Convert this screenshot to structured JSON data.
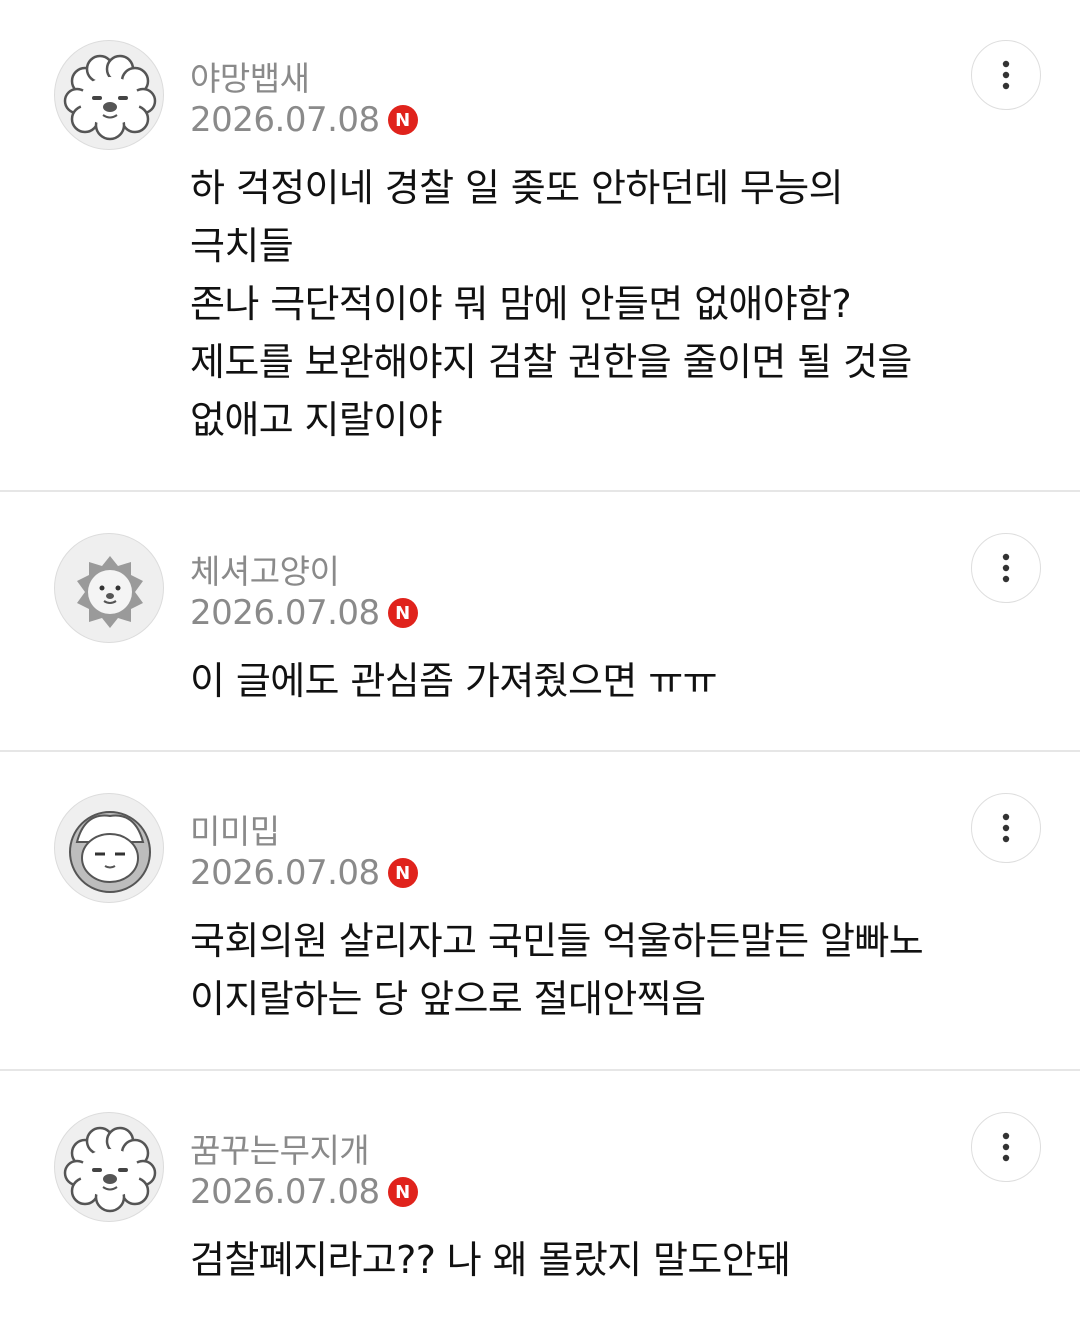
{
  "comments": [
    {
      "avatar_icon": "poodle-dog-icon",
      "username": "야망뱁새",
      "date": "2026.07.08",
      "badge": "N",
      "lines": [
        "하 걱정이네 경찰 일 좆또 안하던데 무능의",
        "극치들",
        "존나 극단적이야 뭐 맘에 안들면 없애야함?",
        "제도를 보완해야지 검찰 권한을 줄이면 될 것을",
        "없애고 지랄이야"
      ]
    },
    {
      "avatar_icon": "lion-icon",
      "username": "체셔고양이",
      "date": "2026.07.08",
      "badge": "N",
      "lines": [
        "이 글에도 관심좀 가져줬으면 ㅠㅠ"
      ]
    },
    {
      "avatar_icon": "hooded-character-icon",
      "username": "미미밉",
      "date": "2026.07.08",
      "badge": "N",
      "lines": [
        "국회의원 살리자고 국민들 억울하든말든 알빠노",
        "이지랄하는 당 앞으로 절대안찍음"
      ]
    },
    {
      "avatar_icon": "poodle-dog-icon",
      "username": "꿈꾸는무지개",
      "date": "2026.07.08",
      "badge": "N",
      "lines": [
        "검찰폐지라고?? 나 왜 몰랐지 말도안돼"
      ]
    }
  ],
  "colors": {
    "badge": "#e0231c",
    "meta_text": "#8a8a8a",
    "body_text": "#111111",
    "divider": "#e6e6e6"
  }
}
